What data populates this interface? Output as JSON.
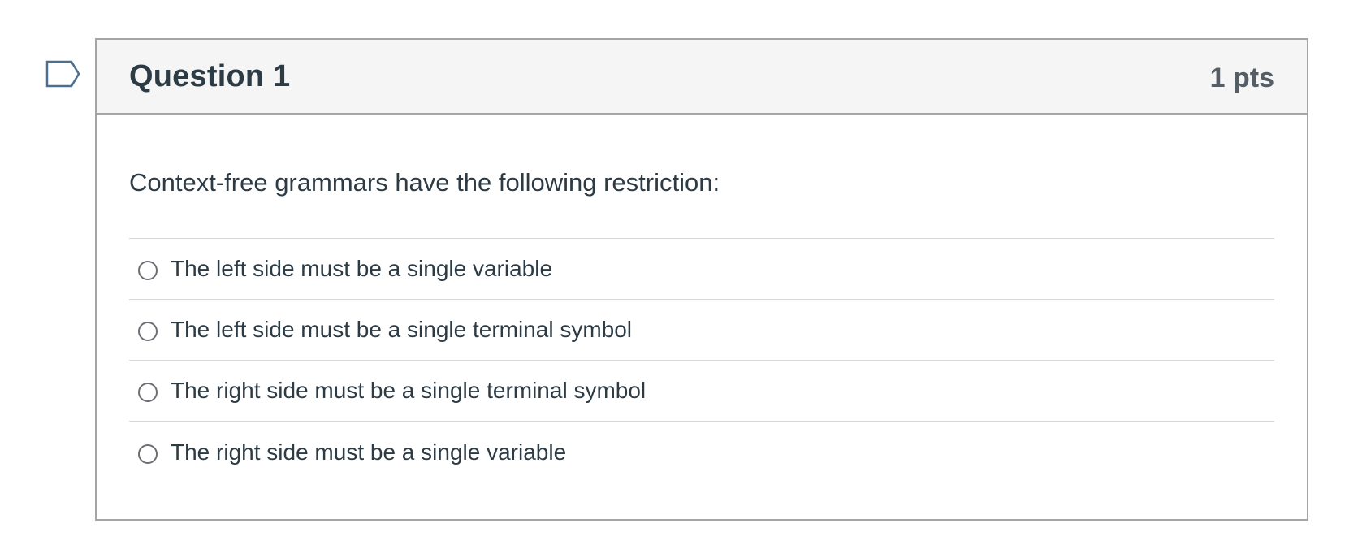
{
  "question": {
    "title": "Question 1",
    "points": "1 pts",
    "text": "Context-free grammars have the following restriction:",
    "answers": [
      {
        "label": "The left side must be a single variable",
        "selected": false
      },
      {
        "label": "The left side must be a single terminal symbol",
        "selected": false
      },
      {
        "label": "The right side must be a single terminal symbol",
        "selected": false
      },
      {
        "label": "The right side must be a single variable",
        "selected": false
      }
    ]
  },
  "icons": {
    "flag": "flag-question-icon"
  },
  "colors": {
    "text": "#2d3b45",
    "points": "#555e66",
    "header_bg": "#f5f5f5",
    "border": "#a5a5a5",
    "divider": "#d7d7d7",
    "flag_stroke": "#4a6f91"
  }
}
